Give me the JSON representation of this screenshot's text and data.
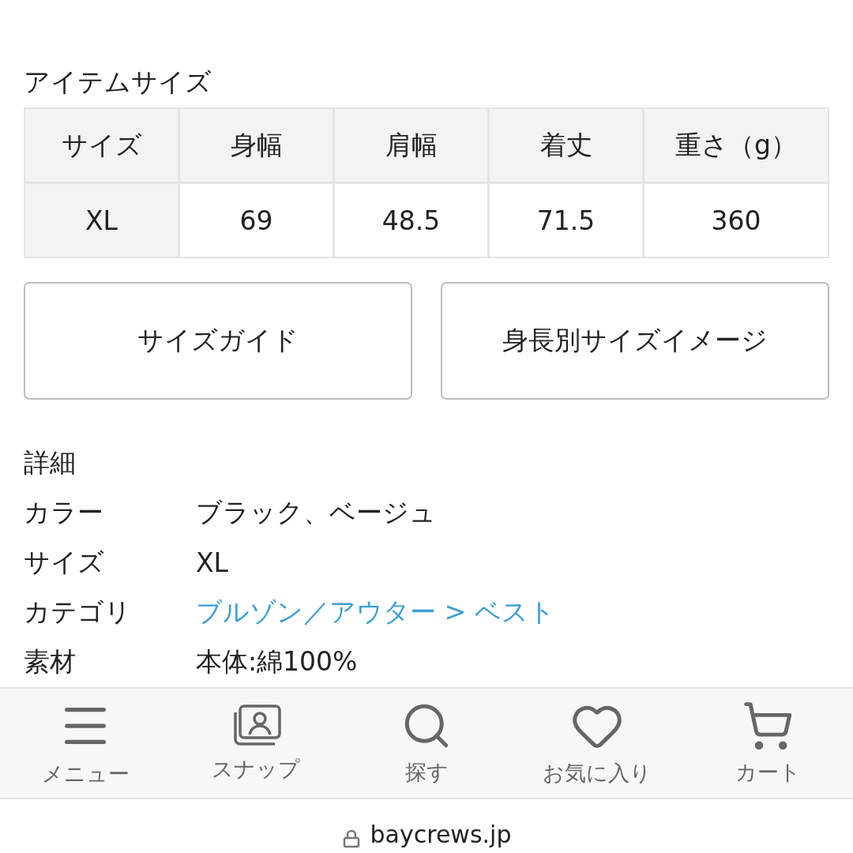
{
  "section_title": "アイテムサイズ",
  "size_table": {
    "columns": [
      "サイズ",
      "身幅",
      "肩幅",
      "着丈",
      "重さ（g）"
    ],
    "rows": [
      [
        "XL",
        "69",
        "48.5",
        "71.5",
        "360"
      ]
    ]
  },
  "buttons": [
    "サイズガイド",
    "身長別サイズイメージ"
  ],
  "details": {
    "title": "詳細",
    "rows": [
      {
        "label": "カラー",
        "value": "ブラック、ベージュ",
        "kind": "text"
      },
      {
        "label": "サイズ",
        "value": "XL",
        "kind": "text"
      },
      {
        "label": "カテゴリ",
        "value": "ブルゾン／アウター > ベスト",
        "kind": "link"
      },
      {
        "label": "素材",
        "value": "本体:綿100%",
        "kind": "text"
      }
    ]
  },
  "bottom_nav": [
    {
      "label": "メニュー"
    },
    {
      "label": "スナップ"
    },
    {
      "label": "探す"
    },
    {
      "label": "お気に入り"
    },
    {
      "label": "カート"
    }
  ],
  "address_bar": {
    "url": "baycrews.jp"
  }
}
